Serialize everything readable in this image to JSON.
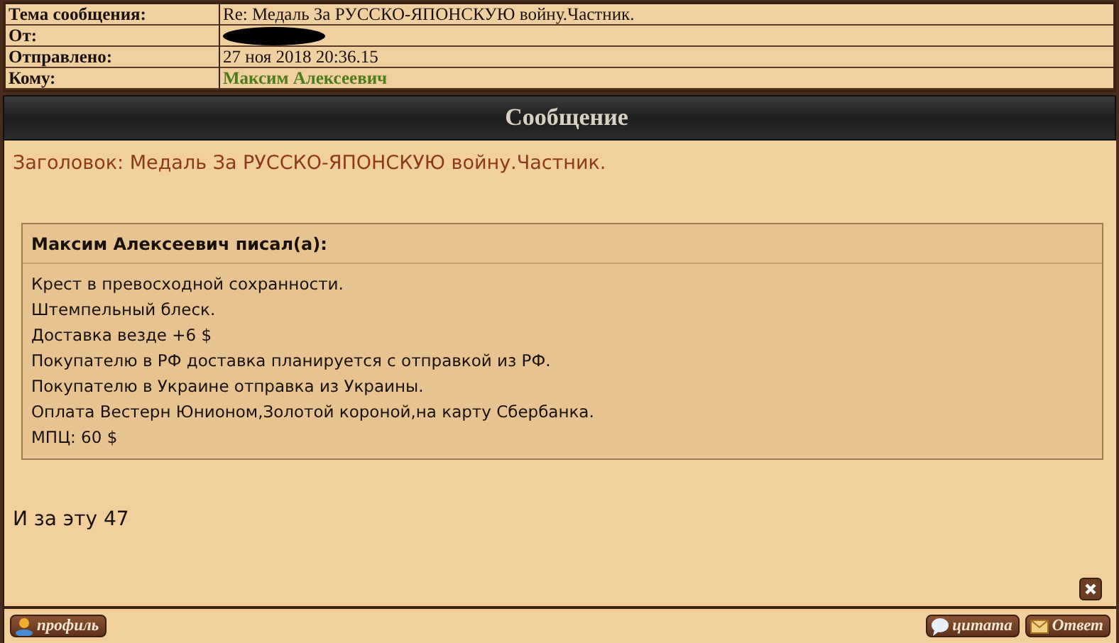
{
  "header": [
    {
      "label": "Тема сообщения:",
      "value": "Re: Медаль За РУССКО-ЯПОНСКУЮ войну.Частник.",
      "kind": "text"
    },
    {
      "label": "От:",
      "kind": "redacted"
    },
    {
      "label": "Отправлено:",
      "value": "27 ноя 2018 20:36.15",
      "kind": "text"
    },
    {
      "label": "Кому:",
      "value": "Максим Алексеевич",
      "kind": "user"
    }
  ],
  "banner": "Сообщение",
  "post": {
    "subject": "Заголовок: Медаль За РУССКО-ЯПОНСКУЮ войну.Частник.",
    "quote": {
      "author": "Максим Алексеевич писал(а):",
      "lines": [
        "Крест в превосходной сохранности.",
        "Штемпельный блеск.",
        "Доставка везде +6 $",
        "Покупателю в РФ доставка планируется с отправкой из РФ.",
        "Покупателю в Украине отправка из Украины.",
        "Оплата Вестерн Юнионом,Золотой короной,на карту Сбербанка.",
        "МПЦ: 60 $"
      ]
    },
    "text": "И за эту 47"
  },
  "footer": {
    "profile": "профиль",
    "quote": "цитата",
    "reply": "Ответ"
  }
}
